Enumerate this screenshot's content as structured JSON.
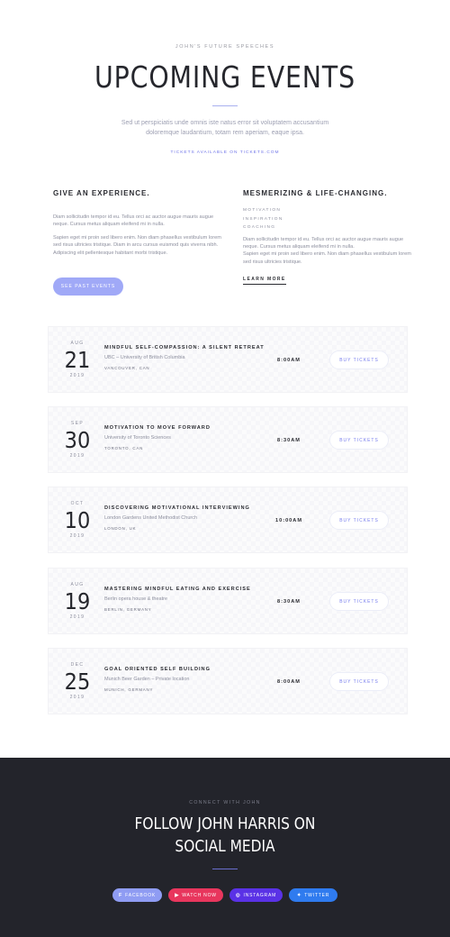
{
  "hero": {
    "kicker": "JOHN'S FUTURE SPEECHES",
    "title": "UPCOMING EVENTS",
    "description": "Sed ut perspiciatis unde omnis iste natus error sit voluptatem accusantium doloremque laudantium, totam rem aperiam, eaque ipsa.",
    "tickets_link": "TICKETS AVAILABLE ON TICKETS.COM"
  },
  "experience": {
    "title": "GIVE AN EXPERIENCE.",
    "p1": "Diam sollicitudin tempor id eu. Tellus orci ac auctor augue mauris augue neque. Cursus metus aliquam eleifend mi in nulla.",
    "p2": "Sapien eget mi proin sed libero enim. Non diam phasellus vestibulum lorem sed risus ultricies tristique. Diam in arcu cursus euismod quis viverra nibh. Adipiscing elit pellentesque habitant morbi tristique.",
    "button": "SEE PAST EVENTS"
  },
  "mesmerizing": {
    "title": "MESMERIZING & LIFE-CHANGING.",
    "tags": [
      "MOTIVATION",
      "INSPIRATION",
      "COACHING"
    ],
    "p1": "Diam sollicitudin tempor id eu. Tellus orci ac auctor augue mauris augue neque. Cursus metus aliquam eleifend mi in nulla.",
    "p2": "Sapien eget mi proin sed libero enim. Non diam phasellus vestibulum lorem sed risus ultricies tristique.",
    "link": "LEARN MORE"
  },
  "events": [
    {
      "month": "AUG",
      "day": "21",
      "year": "2019",
      "title": "MINDFUL SELF-COMPASSION: A SILENT RETREAT",
      "venue": "UBC – University of British Columbia",
      "location": "VANCOUVER, CAN",
      "time": "8:00AM",
      "button": "BUY TICKETS"
    },
    {
      "month": "SEP",
      "day": "30",
      "year": "2019",
      "title": "MOTIVATION TO MOVE FORWARD",
      "venue": "University of Toronto Sciences",
      "location": "TORONTO, CAN",
      "time": "8:30AM",
      "button": "BUY TICKETS"
    },
    {
      "month": "OCT",
      "day": "10",
      "year": "2019",
      "title": "DISCOVERING MOTIVATIONAL INTERVIEWING",
      "venue": "London Gardens United Methodist Church",
      "location": "LONDON, UK",
      "time": "10:00AM",
      "button": "BUY TICKETS"
    },
    {
      "month": "AUG",
      "day": "19",
      "year": "2019",
      "title": "MASTERING MINDFUL EATING AND EXERCISE",
      "venue": "Berlin opera house & theatre",
      "location": "BERLIN, GERMANY",
      "time": "8:30AM",
      "button": "BUY TICKETS"
    },
    {
      "month": "DEC",
      "day": "25",
      "year": "2019",
      "title": "GOAL ORIENTED SELF BUILDING",
      "venue": "Munich Beer Garden – Private location",
      "location": "MUNICH, GERMANY",
      "time": "8:00AM",
      "button": "BUY TICKETS"
    }
  ],
  "footer": {
    "kicker": "CONNECT WITH JOHN",
    "title_line1": "FOLLOW JOHN HARRIS ON",
    "title_line2": "SOCIAL MEDIA",
    "socials": [
      {
        "label": "FACEBOOK",
        "icon": "facebook-icon",
        "color": "#8f9cf3"
      },
      {
        "label": "WATCH NOW",
        "icon": "youtube-icon",
        "color": "#e8365d"
      },
      {
        "label": "INSTAGRAM",
        "icon": "instagram-icon",
        "color": "#5a32e6"
      },
      {
        "label": "TWITTER",
        "icon": "twitter-icon",
        "color": "#2f7bef"
      }
    ]
  }
}
